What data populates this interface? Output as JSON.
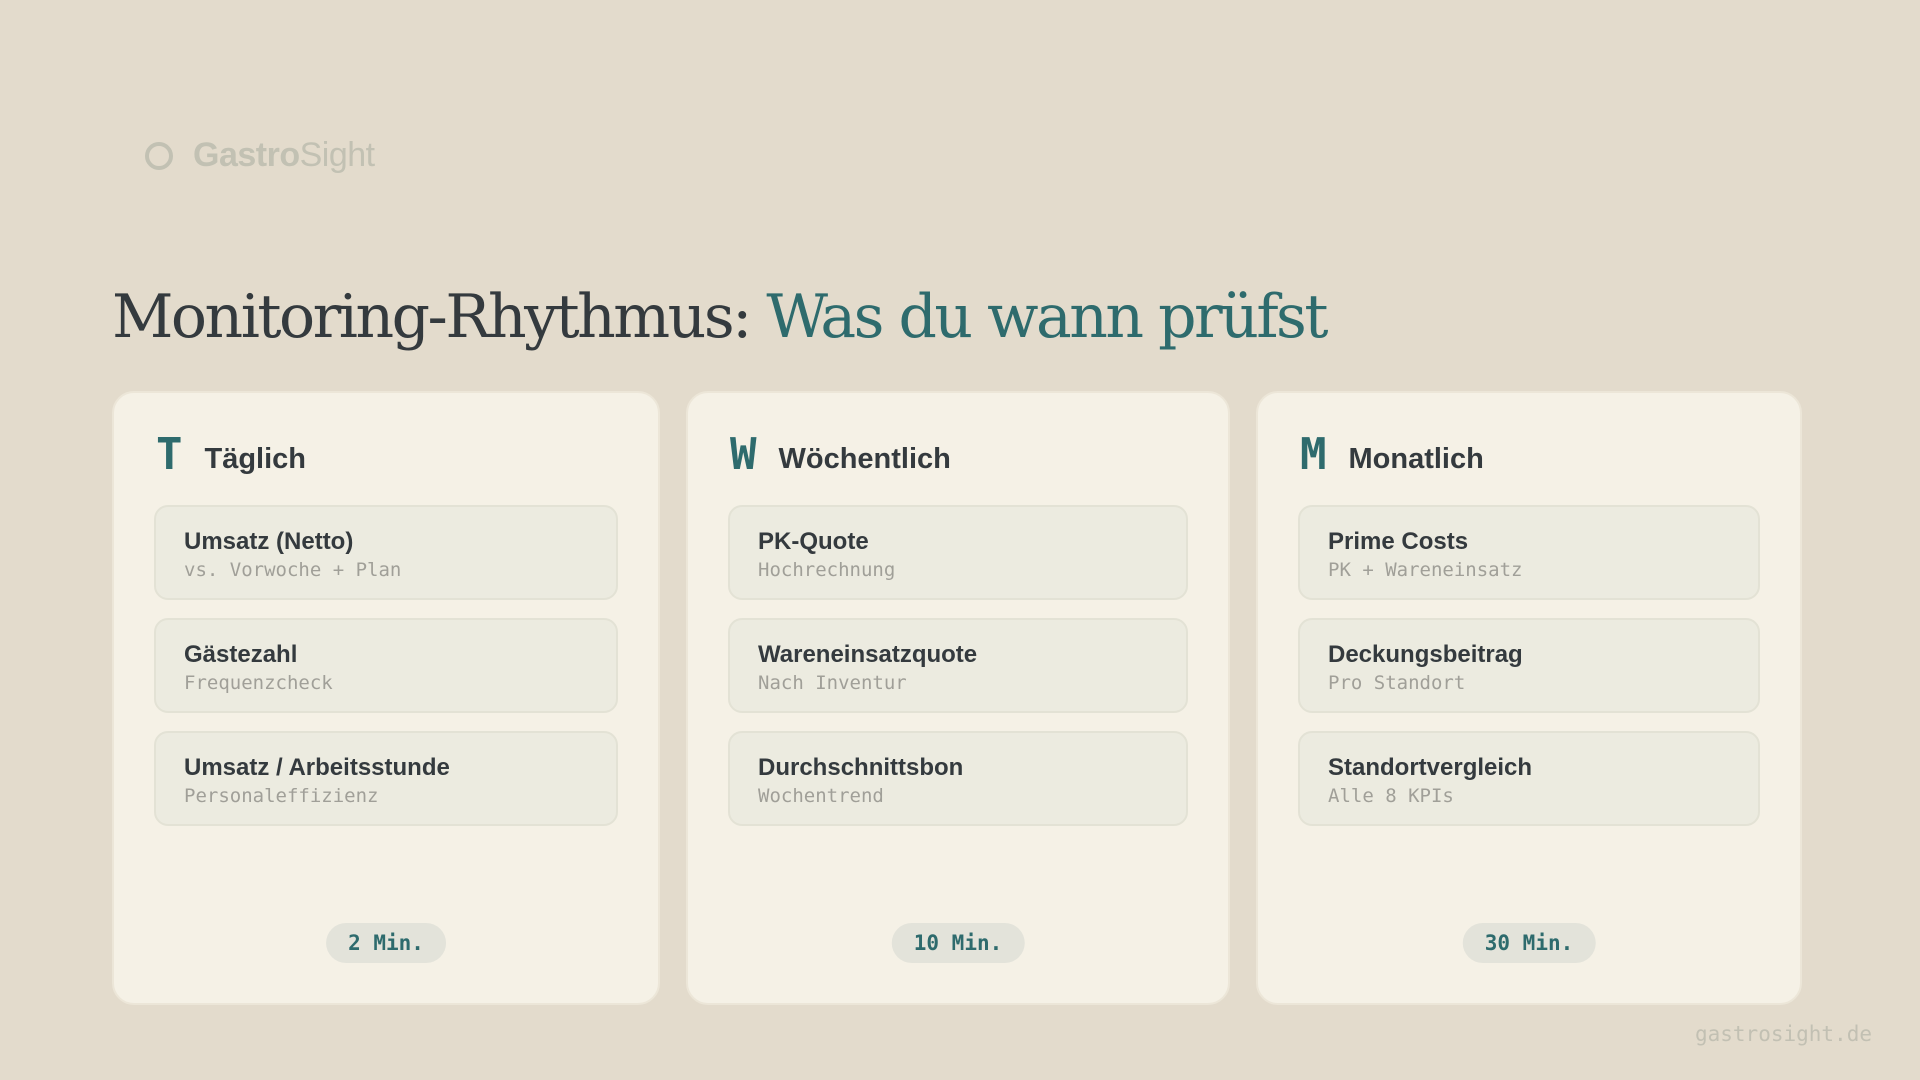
{
  "brand": {
    "bold": "Gastro",
    "light": "Sight",
    "icon": "ring-logo-icon"
  },
  "title": {
    "main": "Monitoring-Rhythmus: ",
    "accent": "Was du wann prüfst"
  },
  "cards": [
    {
      "letter": "T",
      "label": "Täglich",
      "items": [
        {
          "title": "Umsatz (Netto)",
          "sub": "vs. Vorwoche + Plan"
        },
        {
          "title": "Gästezahl",
          "sub": "Frequenzcheck"
        },
        {
          "title": "Umsatz / Arbeitsstunde",
          "sub": "Personaleffizienz"
        }
      ],
      "time": "2 Min."
    },
    {
      "letter": "W",
      "label": "Wöchentlich",
      "items": [
        {
          "title": "PK-Quote",
          "sub": "Hochrechnung"
        },
        {
          "title": "Wareneinsatzquote",
          "sub": "Nach Inventur"
        },
        {
          "title": "Durchschnittsbon",
          "sub": "Wochentrend"
        }
      ],
      "time": "10 Min."
    },
    {
      "letter": "M",
      "label": "Monatlich",
      "items": [
        {
          "title": "Prime Costs",
          "sub": "PK + Wareneinsatz"
        },
        {
          "title": "Deckungsbeitrag",
          "sub": "Pro Standort"
        },
        {
          "title": "Standortvergleich",
          "sub": "Alle 8 KPIs"
        }
      ],
      "time": "30 Min."
    }
  ],
  "footer": "gastrosight.de",
  "colors": {
    "background": "#e3dbcc",
    "accent": "#2e6b6d",
    "text": "#343a3e",
    "card": "#f5f1e6"
  }
}
